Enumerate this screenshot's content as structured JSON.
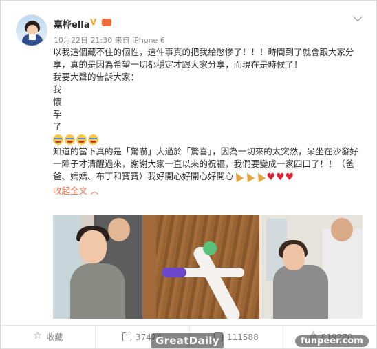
{
  "user": {
    "name": "嘉桦ella",
    "verified_icon": "gold-v-badge",
    "member_icon": "weibo-member-crown-icon",
    "timestamp": "10月22日 21:30",
    "source": "来自 iPhone 6"
  },
  "post": {
    "lines": [
      "以我這個藏不住的個性，這件事真的把我給憋慘了！！！時間到了就會跟大家分享，真的是因為希望一切都穩定才跟大家分享，而現在是時候了！",
      "我要大聲的告訴大家：",
      "我",
      "懷",
      "孕",
      "了"
    ],
    "emojis": [
      "laughing-tears-emoji",
      "laughing-tears-emoji",
      "laughing-tears-emoji",
      "laughing-tears-emoji"
    ],
    "body2": "知道的當下真的是「驚嚇」大過於「驚喜」，因為一切來的太突然，呆坐在沙發好一陣子才清醒過來，謝謝大家一直以來的祝福，我們要變成一家四口了！！（爸爸、媽媽、布丁和寶寶）我好開心好開心好開心",
    "collapse_label": "收起全文 ︿"
  },
  "photos": [
    {
      "alt": "couple-hugging-photo"
    },
    {
      "alt": "pregnancy-tests-photo"
    },
    {
      "alt": "couple-looking-at-test-photo"
    }
  ],
  "actions": {
    "favorite": "收藏",
    "reposts": "37474",
    "comments": "111588",
    "likes": "819270"
  },
  "watermarks": {
    "greatdaily": "GreatDaily",
    "funpeer": "funpeer.com"
  }
}
